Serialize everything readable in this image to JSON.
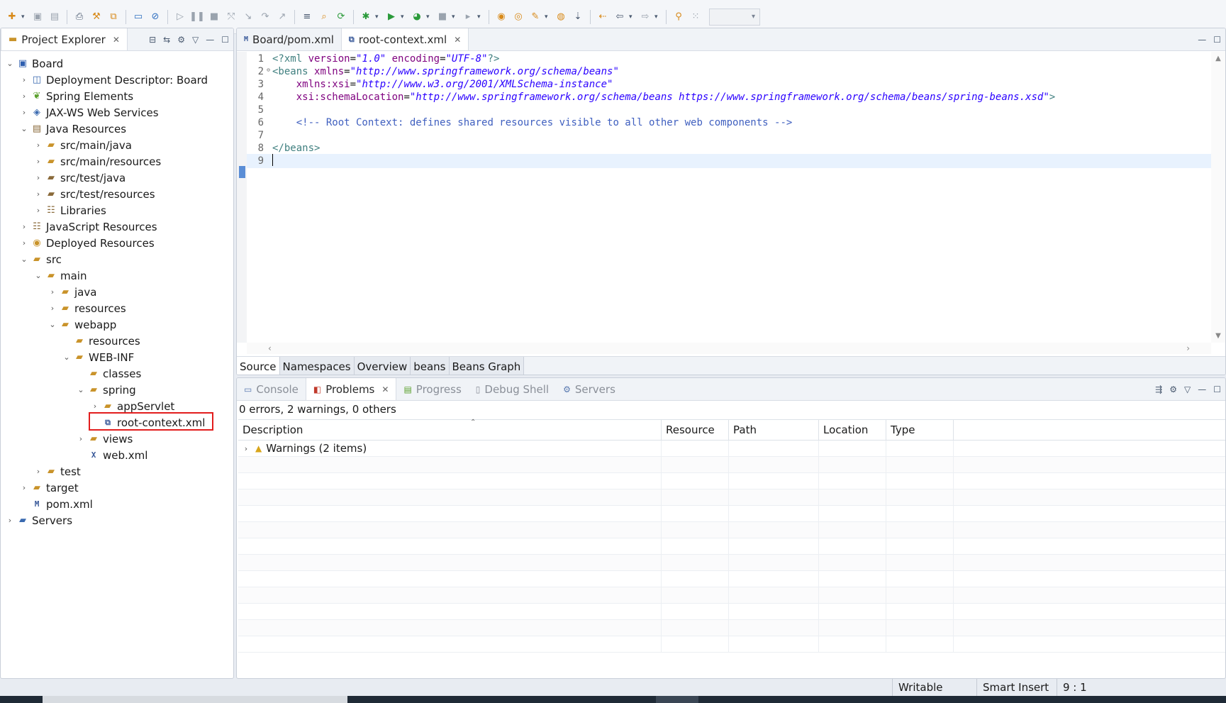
{
  "toolbar": {
    "icons": [
      "new-icon",
      "save-icon",
      "save-all-icon",
      "print-icon",
      "build-icon",
      "external-tools-icon",
      "terminal-icon",
      "skip-breakpoints-icon",
      "resume-icon",
      "suspend-icon",
      "terminate-icon",
      "disconnect-icon",
      "step-into-icon",
      "step-over-icon",
      "step-return-icon",
      "toggle-mark-occurrences-icon",
      "search-icon",
      "refresh-icon",
      "debug-icon",
      "run-icon",
      "coverage-icon",
      "stop-icon",
      "external-run-icon",
      "open-type-icon",
      "open-task-icon",
      "pen-icon",
      "spring-open-icon",
      "back-icon",
      "forward-icon",
      "next-annotation-icon",
      "previous-annotation-icon",
      "pin-icon",
      "grid-icon"
    ]
  },
  "explorer": {
    "tab_label": "Project Explorer",
    "items": [
      {
        "label": "Board",
        "icon": "project-icon"
      },
      {
        "label": "Deployment Descriptor: Board",
        "icon": "descriptor-icon"
      },
      {
        "label": "Spring Elements",
        "icon": "spring-icon"
      },
      {
        "label": "JAX-WS Web Services",
        "icon": "webservice-icon"
      },
      {
        "label": "Java Resources",
        "icon": "java-resources-icon"
      },
      {
        "label": "src/main/java",
        "icon": "package-folder-icon"
      },
      {
        "label": "src/main/resources",
        "icon": "package-folder-icon"
      },
      {
        "label": "src/test/java",
        "icon": "package-folder-icon"
      },
      {
        "label": "src/test/resources",
        "icon": "package-folder-icon"
      },
      {
        "label": "Libraries",
        "icon": "library-icon"
      },
      {
        "label": "JavaScript Resources",
        "icon": "js-resources-icon"
      },
      {
        "label": "Deployed Resources",
        "icon": "deployed-icon"
      },
      {
        "label": "src",
        "icon": "folder-icon"
      },
      {
        "label": "main",
        "icon": "folder-icon"
      },
      {
        "label": "java",
        "icon": "folder-icon"
      },
      {
        "label": "resources",
        "icon": "folder-icon"
      },
      {
        "label": "webapp",
        "icon": "folder-icon"
      },
      {
        "label": "resources",
        "icon": "folder-icon"
      },
      {
        "label": "WEB-INF",
        "icon": "folder-icon"
      },
      {
        "label": "classes",
        "icon": "folder-icon"
      },
      {
        "label": "spring",
        "icon": "folder-icon"
      },
      {
        "label": "appServlet",
        "icon": "folder-icon"
      },
      {
        "label": "root-context.xml",
        "icon": "spring-xml-icon"
      },
      {
        "label": "views",
        "icon": "folder-icon"
      },
      {
        "label": "web.xml",
        "icon": "xml-file-icon"
      },
      {
        "label": "test",
        "icon": "folder-icon"
      },
      {
        "label": "target",
        "icon": "folder-icon"
      },
      {
        "label": "pom.xml",
        "icon": "maven-file-icon"
      },
      {
        "label": "Servers",
        "icon": "server-icon"
      }
    ]
  },
  "editor": {
    "tabs": [
      {
        "label": "Board/pom.xml"
      },
      {
        "label": "root-context.xml"
      }
    ],
    "line_numbers": [
      "1",
      "2",
      "3",
      "4",
      "5",
      "6",
      "7",
      "8",
      "9"
    ],
    "lines": {
      "l1_pi_open": "<?xml ",
      "l1_attr1": "version",
      "l1_eq1": "=",
      "l1_val1": "\"1.0\"",
      "l1_sp": " ",
      "l1_attr2": "encoding",
      "l1_eq2": "=",
      "l1_val2": "\"UTF-8\"",
      "l1_pi_close": "?>",
      "l2_open": "<beans ",
      "l2_attr": "xmlns",
      "l2_eq": "=",
      "l2_val": "\"http://www.springframework.org/schema/beans\"",
      "l3_indent": "    ",
      "l3_attr": "xmlns:xsi",
      "l3_eq": "=",
      "l3_val": "\"http://www.w3.org/2001/XMLSchema-instance\"",
      "l4_indent": "    ",
      "l4_attr": "xsi:schemaLocation",
      "l4_eq": "=",
      "l4_val": "\"http://www.springframework.org/schema/beans https://www.springframework.org/schema/beans/spring-beans.xsd\"",
      "l4_close": ">",
      "l6_indent": "    ",
      "l6_comment": "<!-- Root Context: defines shared resources visible to all other web components -->",
      "l8_close": "</beans>"
    },
    "page_tabs": [
      "Source",
      "Namespaces",
      "Overview",
      "beans",
      "Beans Graph"
    ]
  },
  "problems": {
    "tabs": [
      {
        "label": "Console",
        "icon": "console-icon"
      },
      {
        "label": "Problems",
        "icon": "problems-icon"
      },
      {
        "label": "Progress",
        "icon": "progress-icon"
      },
      {
        "label": "Debug Shell",
        "icon": "debug-shell-icon"
      },
      {
        "label": "Servers",
        "icon": "servers-icon"
      }
    ],
    "summary": "0 errors, 2 warnings, 0 others",
    "columns": [
      "Description",
      "Resource",
      "Path",
      "Location",
      "Type"
    ],
    "rows": [
      {
        "description": "Warnings (2 items)",
        "resource": "",
        "path": "",
        "location": "",
        "type": ""
      }
    ]
  },
  "status": {
    "writable": "Writable",
    "insert_mode": "Smart Insert",
    "position": "9 : 1"
  }
}
